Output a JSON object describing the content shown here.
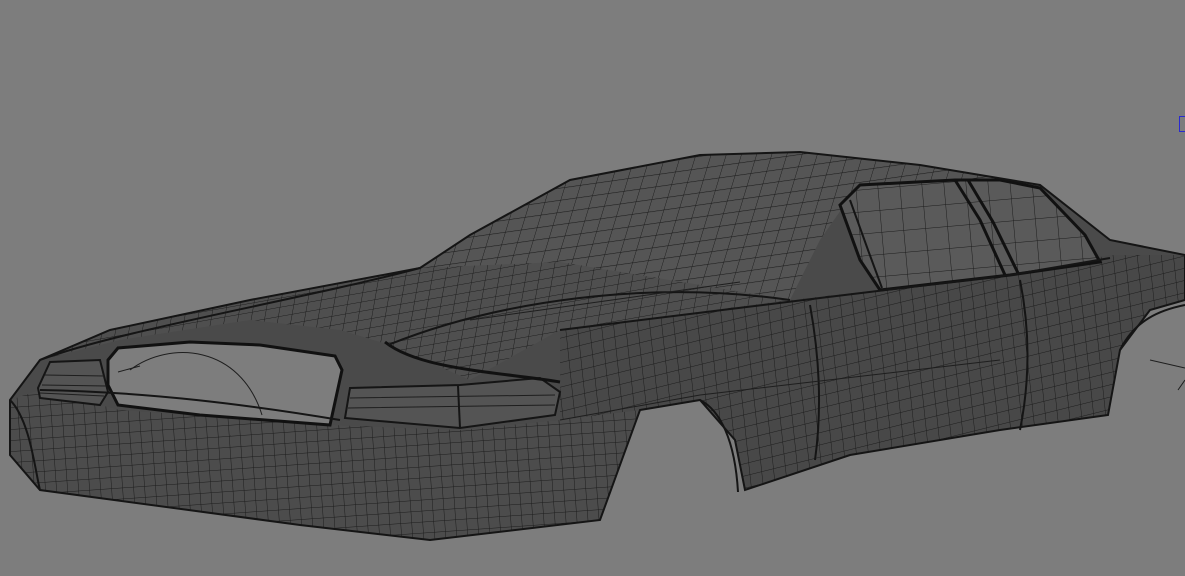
{
  "viewport": {
    "background_color": "#7d7d7d",
    "model": "car-body-wireframe",
    "display_mode": "wireframe-on-shaded",
    "mesh_color": "#4a4a4a",
    "wire_color": "#1e1e1e",
    "manipulator_color": "#2a2ad0"
  }
}
